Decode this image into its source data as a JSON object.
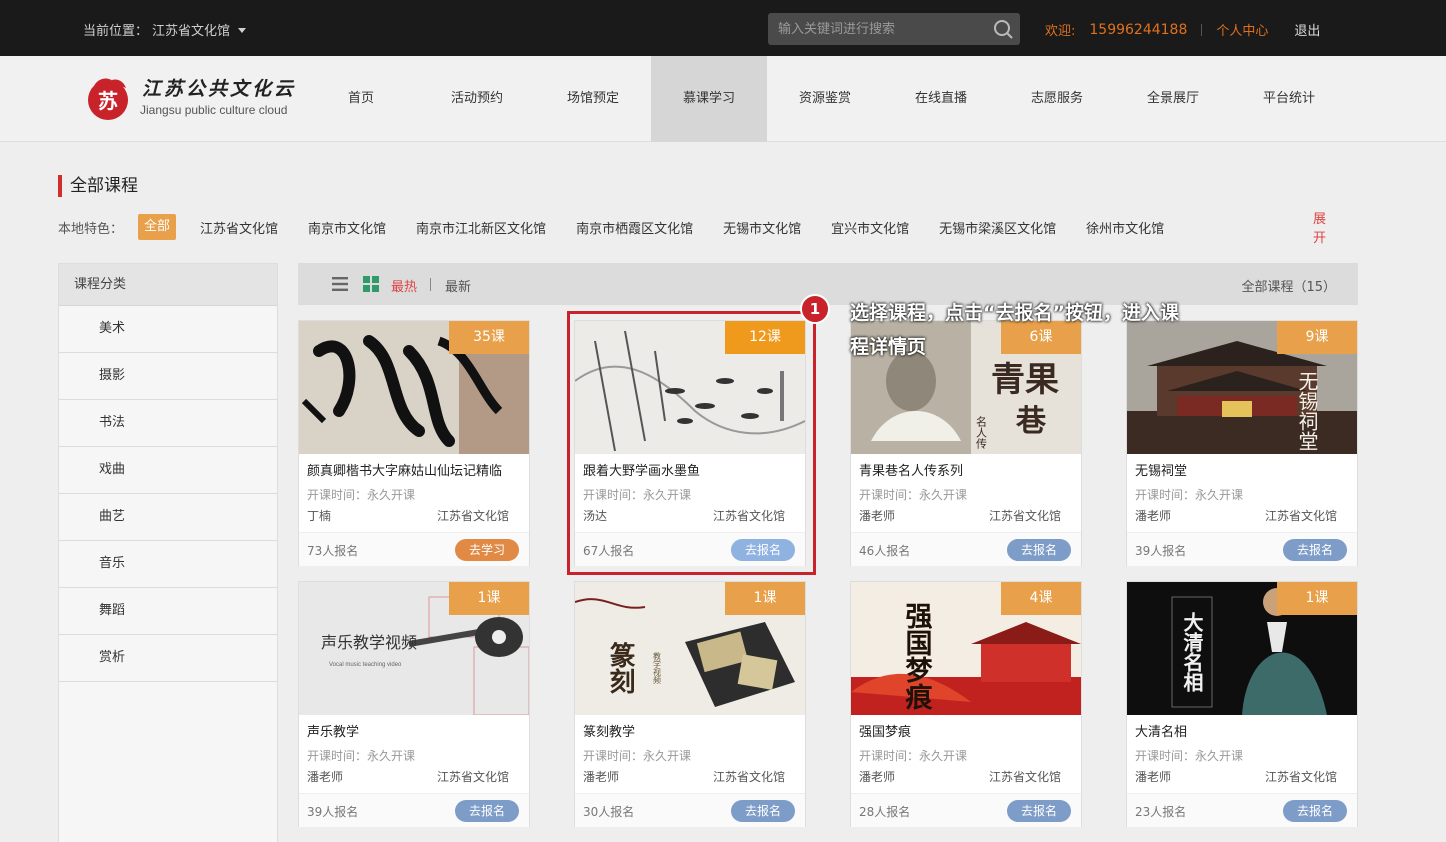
{
  "topbar": {
    "location_label": "当前位置：",
    "location_value": "江苏省文化馆",
    "search_placeholder": "输入关键词进行搜索",
    "welcome": "欢迎:",
    "phone": "15996244188",
    "personal_center": "个人中心",
    "logout": "退出"
  },
  "logo": {
    "cn": "江苏公共文化云",
    "en": "Jiangsu public culture cloud",
    "seal": "苏"
  },
  "nav": [
    {
      "label": "首页",
      "active": false
    },
    {
      "label": "活动预约",
      "active": false
    },
    {
      "label": "场馆预定",
      "active": false
    },
    {
      "label": "慕课学习",
      "active": true
    },
    {
      "label": "资源鉴赏",
      "active": false
    },
    {
      "label": "在线直播",
      "active": false
    },
    {
      "label": "志愿服务",
      "active": false
    },
    {
      "label": "全景展厅",
      "active": false
    },
    {
      "label": "平台统计",
      "active": false
    }
  ],
  "section_title": "全部课程",
  "filter": {
    "label": "本地特色：",
    "all": "全部",
    "options": [
      "江苏省文化馆",
      "南京市文化馆",
      "南京市江北新区文化馆",
      "南京市栖霞区文化馆",
      "无锡市文化馆",
      "宜兴市文化馆",
      "无锡市梁溪区文化馆",
      "徐州市文化馆"
    ],
    "expand": "展开"
  },
  "sidebar": {
    "head": "课程分类",
    "items": [
      "美术",
      "摄影",
      "书法",
      "戏曲",
      "曲艺",
      "音乐",
      "舞蹈",
      "赏析"
    ]
  },
  "toolbar": {
    "hot": "最热",
    "new": "最新",
    "total": "全部课程（15）"
  },
  "cards": [
    {
      "badge": "35课",
      "title": "颜真卿楷书大字麻姑山仙坛记精临",
      "time": "开课时间：永久开课",
      "teacher": "丁楠",
      "venue": "江苏省文化馆",
      "count": "73人报名",
      "button": "去学习"
    },
    {
      "badge": "12课",
      "title": "跟着大野学画水墨鱼",
      "time": "开课时间：永久开课",
      "teacher": "汤达",
      "venue": "江苏省文化馆",
      "count": "67人报名",
      "button": "去报名"
    },
    {
      "badge": "6课",
      "title": "青果巷名人传系列",
      "time": "开课时间：永久开课",
      "teacher": "潘老师",
      "venue": "江苏省文化馆",
      "count": "46人报名",
      "button": "去报名"
    },
    {
      "badge": "9课",
      "title": "无锡祠堂",
      "time": "开课时间：永久开课",
      "teacher": "潘老师",
      "venue": "江苏省文化馆",
      "count": "39人报名",
      "button": "去报名"
    },
    {
      "badge": "1课",
      "title": "声乐教学",
      "time": "开课时间：永久开课",
      "teacher": "潘老师",
      "venue": "江苏省文化馆",
      "count": "39人报名",
      "button": "去报名"
    },
    {
      "badge": "1课",
      "title": "篆刻教学",
      "time": "开课时间：永久开课",
      "teacher": "潘老师",
      "venue": "江苏省文化馆",
      "count": "30人报名",
      "button": "去报名"
    },
    {
      "badge": "4课",
      "title": "强国梦痕",
      "time": "开课时间：永久开课",
      "teacher": "潘老师",
      "venue": "江苏省文化馆",
      "count": "28人报名",
      "button": "去报名"
    },
    {
      "badge": "1课",
      "title": "大清名相",
      "time": "开课时间：永久开课",
      "teacher": "潘老师",
      "venue": "江苏省文化馆",
      "count": "23人报名",
      "button": "去报名"
    }
  ],
  "thumb_text": {
    "c3_a": "青果",
    "c3_b": "巷",
    "c3_c": "名人传",
    "c4": "无锡祠堂",
    "c5": "声乐教学视频",
    "c5_en": "Vocal music teaching video",
    "c6": "篆刻",
    "c6_sub": "教学视频",
    "c7": "强国梦痕",
    "c8": "大清名相"
  },
  "annotation": {
    "step": "1",
    "text": "选择课程，点击“去报名”按钮，进入课程详情页"
  },
  "colors": {
    "accent_orange": "#e8a04a",
    "highlight_red": "#c8232b",
    "button_blue": "#7d9cc8"
  }
}
